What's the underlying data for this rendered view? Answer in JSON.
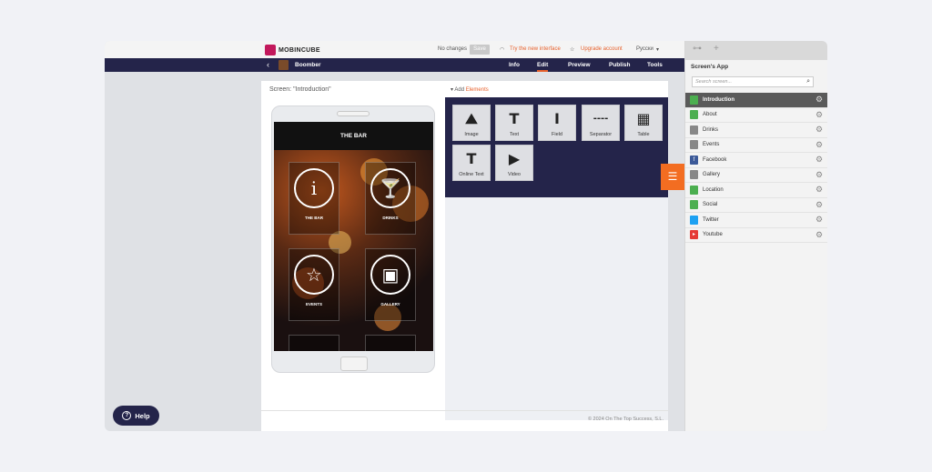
{
  "app": {
    "logo_text": "MOBINCUBE"
  },
  "topbar": {
    "status": "No changes",
    "save_label": "Save",
    "new_interface": "Try the new interface",
    "upgrade": "Upgrade account",
    "language": "Русски"
  },
  "nav": {
    "back_icon": "chevron-left-icon",
    "app_name": "Boomber",
    "tabs": [
      {
        "label": "Info"
      },
      {
        "label": "Edit"
      },
      {
        "label": "Preview"
      },
      {
        "label": "Publish"
      },
      {
        "label": "Tools"
      }
    ],
    "active_tab": "Edit"
  },
  "editor": {
    "screen_label": "Screen: \"Introduction\"",
    "add_label": "Add",
    "elements_label": "Elements"
  },
  "phone": {
    "header": "THE BAR",
    "tiles": [
      {
        "label": "THE BAR",
        "icon": "info-icon",
        "glyph": "i"
      },
      {
        "label": "DRINKS",
        "icon": "cocktail-icon",
        "glyph": "🍸"
      },
      {
        "label": "EVENTS",
        "icon": "star-icon",
        "glyph": "☆"
      },
      {
        "label": "GALLERY",
        "icon": "picture-icon",
        "glyph": "▣"
      }
    ]
  },
  "elements": [
    {
      "label": "Image",
      "icon": "image-icon",
      "glyph": "⛰"
    },
    {
      "label": "Text",
      "icon": "text-icon",
      "glyph": "T"
    },
    {
      "label": "Field",
      "icon": "field-icon",
      "glyph": "I"
    },
    {
      "label": "Separator",
      "icon": "separator-icon",
      "glyph": "----"
    },
    {
      "label": "Table",
      "icon": "table-icon",
      "glyph": "▦"
    },
    {
      "label": "Online Text",
      "icon": "online-text-icon",
      "glyph": "T"
    },
    {
      "label": "Video",
      "icon": "video-icon",
      "glyph": "▶"
    }
  ],
  "footer": {
    "copyright": "© 2024 On The Top Success, S.L."
  },
  "help": {
    "label": "Help"
  },
  "sidebar": {
    "title": "Screen's App",
    "search_placeholder": "Search screen...",
    "items": [
      {
        "label": "Introduction",
        "icon": "screen-icon",
        "color": "#4caf50",
        "active": true
      },
      {
        "label": "About",
        "icon": "screen-icon",
        "color": "#4caf50"
      },
      {
        "label": "Drinks",
        "icon": "list-icon",
        "color": "#888888"
      },
      {
        "label": "Events",
        "icon": "list-icon",
        "color": "#888888"
      },
      {
        "label": "Facebook",
        "icon": "facebook-icon",
        "color": "#3b5998"
      },
      {
        "label": "Gallery",
        "icon": "list-icon",
        "color": "#888888"
      },
      {
        "label": "Location",
        "icon": "screen-icon",
        "color": "#4caf50"
      },
      {
        "label": "Social",
        "icon": "screen-icon",
        "color": "#4caf50"
      },
      {
        "label": "Twitter",
        "icon": "twitter-icon",
        "color": "#1da1f2"
      },
      {
        "label": "Youtube",
        "icon": "youtube-icon",
        "color": "#e53935"
      }
    ]
  },
  "colors": {
    "accent": "#e8612c",
    "navy": "#24244a",
    "orange_tab": "#f36d21"
  }
}
